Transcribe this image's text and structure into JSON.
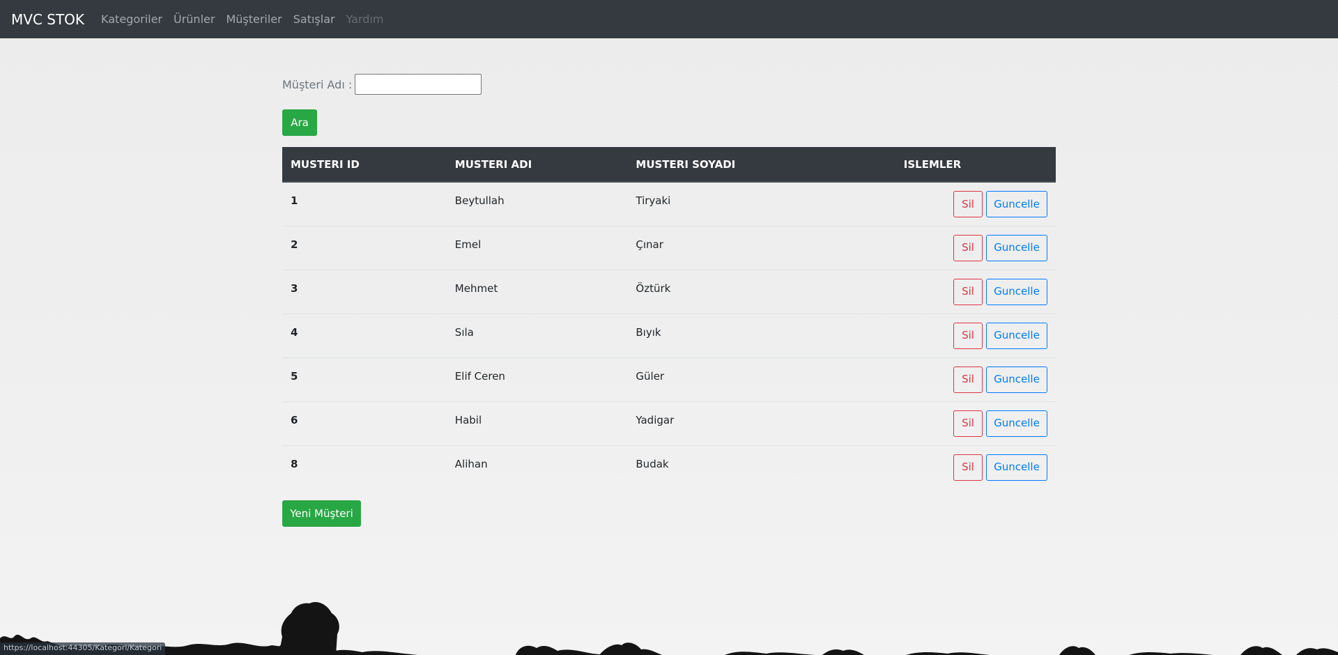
{
  "navbar": {
    "brand": "MVC STOK",
    "links": [
      {
        "label": "Kategoriler"
      },
      {
        "label": "Ürünler"
      },
      {
        "label": "Müşteriler"
      },
      {
        "label": "Satışlar"
      },
      {
        "label": "Yardım",
        "disabled": true
      }
    ]
  },
  "search": {
    "label": "Müşteri Adı :",
    "value": "",
    "button_label": "Ara"
  },
  "table": {
    "headers": [
      "MUSTERI ID",
      "MUSTERI ADI",
      "MUSTERI SOYADI",
      "ISLEMLER"
    ],
    "rows": [
      {
        "id": "1",
        "ad": "Beytullah",
        "soyad": "Tiryaki"
      },
      {
        "id": "2",
        "ad": "Emel",
        "soyad": "Çınar"
      },
      {
        "id": "3",
        "ad": "Mehmet",
        "soyad": "Öztürk"
      },
      {
        "id": "4",
        "ad": "Sıla",
        "soyad": "Bıyık"
      },
      {
        "id": "5",
        "ad": "Elif Ceren",
        "soyad": "Güler"
      },
      {
        "id": "6",
        "ad": "Habil",
        "soyad": "Yadigar"
      },
      {
        "id": "8",
        "ad": "Alihan",
        "soyad": "Budak"
      }
    ],
    "delete_label": "Sil",
    "update_label": "Guncelle"
  },
  "new_button_label": "Yeni Müşteri",
  "status_bar": {
    "url": "https://localhost:44305/Kategori/Kategori"
  },
  "colors": {
    "navbar": "#343a40",
    "success": "#28a745",
    "danger": "#dc3545",
    "primary": "#007bff"
  }
}
